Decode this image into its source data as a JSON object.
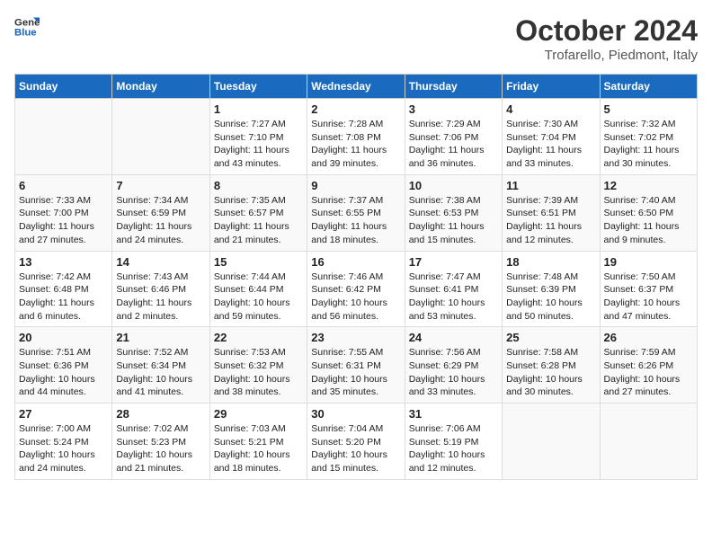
{
  "logo": {
    "line1": "General",
    "line2": "Blue"
  },
  "header": {
    "month": "October 2024",
    "location": "Trofarello, Piedmont, Italy"
  },
  "weekdays": [
    "Sunday",
    "Monday",
    "Tuesday",
    "Wednesday",
    "Thursday",
    "Friday",
    "Saturday"
  ],
  "weeks": [
    [
      {
        "day": "",
        "info": ""
      },
      {
        "day": "",
        "info": ""
      },
      {
        "day": "1",
        "info": "Sunrise: 7:27 AM\nSunset: 7:10 PM\nDaylight: 11 hours and 43 minutes."
      },
      {
        "day": "2",
        "info": "Sunrise: 7:28 AM\nSunset: 7:08 PM\nDaylight: 11 hours and 39 minutes."
      },
      {
        "day": "3",
        "info": "Sunrise: 7:29 AM\nSunset: 7:06 PM\nDaylight: 11 hours and 36 minutes."
      },
      {
        "day": "4",
        "info": "Sunrise: 7:30 AM\nSunset: 7:04 PM\nDaylight: 11 hours and 33 minutes."
      },
      {
        "day": "5",
        "info": "Sunrise: 7:32 AM\nSunset: 7:02 PM\nDaylight: 11 hours and 30 minutes."
      }
    ],
    [
      {
        "day": "6",
        "info": "Sunrise: 7:33 AM\nSunset: 7:00 PM\nDaylight: 11 hours and 27 minutes."
      },
      {
        "day": "7",
        "info": "Sunrise: 7:34 AM\nSunset: 6:59 PM\nDaylight: 11 hours and 24 minutes."
      },
      {
        "day": "8",
        "info": "Sunrise: 7:35 AM\nSunset: 6:57 PM\nDaylight: 11 hours and 21 minutes."
      },
      {
        "day": "9",
        "info": "Sunrise: 7:37 AM\nSunset: 6:55 PM\nDaylight: 11 hours and 18 minutes."
      },
      {
        "day": "10",
        "info": "Sunrise: 7:38 AM\nSunset: 6:53 PM\nDaylight: 11 hours and 15 minutes."
      },
      {
        "day": "11",
        "info": "Sunrise: 7:39 AM\nSunset: 6:51 PM\nDaylight: 11 hours and 12 minutes."
      },
      {
        "day": "12",
        "info": "Sunrise: 7:40 AM\nSunset: 6:50 PM\nDaylight: 11 hours and 9 minutes."
      }
    ],
    [
      {
        "day": "13",
        "info": "Sunrise: 7:42 AM\nSunset: 6:48 PM\nDaylight: 11 hours and 6 minutes."
      },
      {
        "day": "14",
        "info": "Sunrise: 7:43 AM\nSunset: 6:46 PM\nDaylight: 11 hours and 2 minutes."
      },
      {
        "day": "15",
        "info": "Sunrise: 7:44 AM\nSunset: 6:44 PM\nDaylight: 10 hours and 59 minutes."
      },
      {
        "day": "16",
        "info": "Sunrise: 7:46 AM\nSunset: 6:42 PM\nDaylight: 10 hours and 56 minutes."
      },
      {
        "day": "17",
        "info": "Sunrise: 7:47 AM\nSunset: 6:41 PM\nDaylight: 10 hours and 53 minutes."
      },
      {
        "day": "18",
        "info": "Sunrise: 7:48 AM\nSunset: 6:39 PM\nDaylight: 10 hours and 50 minutes."
      },
      {
        "day": "19",
        "info": "Sunrise: 7:50 AM\nSunset: 6:37 PM\nDaylight: 10 hours and 47 minutes."
      }
    ],
    [
      {
        "day": "20",
        "info": "Sunrise: 7:51 AM\nSunset: 6:36 PM\nDaylight: 10 hours and 44 minutes."
      },
      {
        "day": "21",
        "info": "Sunrise: 7:52 AM\nSunset: 6:34 PM\nDaylight: 10 hours and 41 minutes."
      },
      {
        "day": "22",
        "info": "Sunrise: 7:53 AM\nSunset: 6:32 PM\nDaylight: 10 hours and 38 minutes."
      },
      {
        "day": "23",
        "info": "Sunrise: 7:55 AM\nSunset: 6:31 PM\nDaylight: 10 hours and 35 minutes."
      },
      {
        "day": "24",
        "info": "Sunrise: 7:56 AM\nSunset: 6:29 PM\nDaylight: 10 hours and 33 minutes."
      },
      {
        "day": "25",
        "info": "Sunrise: 7:58 AM\nSunset: 6:28 PM\nDaylight: 10 hours and 30 minutes."
      },
      {
        "day": "26",
        "info": "Sunrise: 7:59 AM\nSunset: 6:26 PM\nDaylight: 10 hours and 27 minutes."
      }
    ],
    [
      {
        "day": "27",
        "info": "Sunrise: 7:00 AM\nSunset: 5:24 PM\nDaylight: 10 hours and 24 minutes."
      },
      {
        "day": "28",
        "info": "Sunrise: 7:02 AM\nSunset: 5:23 PM\nDaylight: 10 hours and 21 minutes."
      },
      {
        "day": "29",
        "info": "Sunrise: 7:03 AM\nSunset: 5:21 PM\nDaylight: 10 hours and 18 minutes."
      },
      {
        "day": "30",
        "info": "Sunrise: 7:04 AM\nSunset: 5:20 PM\nDaylight: 10 hours and 15 minutes."
      },
      {
        "day": "31",
        "info": "Sunrise: 7:06 AM\nSunset: 5:19 PM\nDaylight: 10 hours and 12 minutes."
      },
      {
        "day": "",
        "info": ""
      },
      {
        "day": "",
        "info": ""
      }
    ]
  ]
}
